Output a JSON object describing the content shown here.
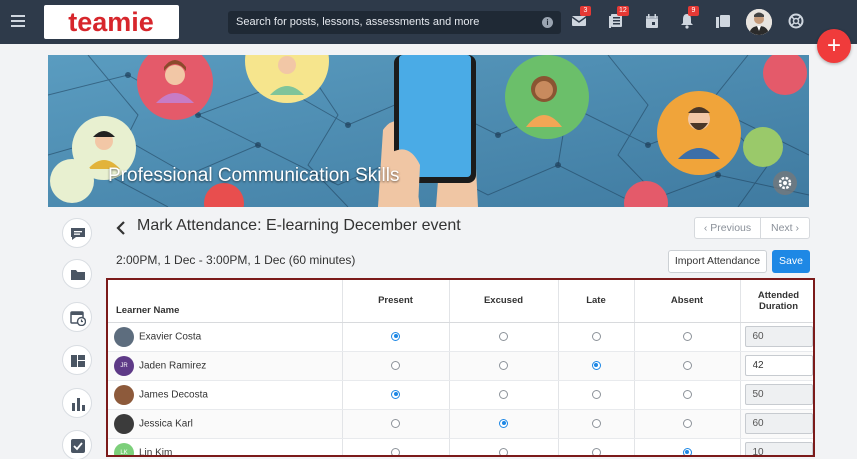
{
  "header": {
    "logo_text": "teamie",
    "search_placeholder": "Search for posts, lessons, assessments and more",
    "notifications": {
      "messages": "3",
      "posts": "12",
      "alerts": "9"
    },
    "icons": [
      "menu-icon",
      "info-icon",
      "mail-icon",
      "news-feed-icon",
      "calendar-icon",
      "bell-icon",
      "copy-icon",
      "user-avatar",
      "help-icon"
    ],
    "fab_label": "+"
  },
  "banner": {
    "course_title": "Professional Communication Skills"
  },
  "sidebar": {
    "items": [
      "discussion-icon",
      "folder-icon",
      "schedule-icon",
      "dashboard-icon",
      "bar-chart-icon",
      "checkbox-icon"
    ]
  },
  "page": {
    "title": "Mark Attendance: E-learning December event",
    "time_range": "2:00PM, 1 Dec - 3:00PM, 1 Dec (60 minutes)",
    "previous_label": "‹ Previous",
    "next_label": "Next ›",
    "import_label": "Import Attendance",
    "save_label": "Save"
  },
  "table": {
    "columns": [
      "Learner Name",
      "Present",
      "Excused",
      "Late",
      "Absent",
      "Attended Duration"
    ],
    "rows": [
      {
        "name": "Exavier Costa",
        "initials": "",
        "avatar_color": "#5d6d7e",
        "status": "present",
        "duration": "60",
        "editable": false
      },
      {
        "name": "Jaden Ramirez",
        "initials": "JR",
        "avatar_color": "#5e3a87",
        "status": "late",
        "duration": "42",
        "editable": true
      },
      {
        "name": "James Decosta",
        "initials": "",
        "avatar_color": "#8d5a3b",
        "status": "present",
        "duration": "50",
        "editable": false
      },
      {
        "name": "Jessica Karl",
        "initials": "",
        "avatar_color": "#3b3b3b",
        "status": "excused",
        "duration": "60",
        "editable": false
      },
      {
        "name": "Lin Kim",
        "initials": "LK",
        "avatar_color": "#7ccf7a",
        "status": "absent",
        "duration": "10",
        "editable": false
      }
    ]
  },
  "colors": {
    "topbar": "#2e3a4a",
    "accent": "#1e88e5",
    "fab": "#f03b3b",
    "table_border": "#7b1a1a"
  }
}
